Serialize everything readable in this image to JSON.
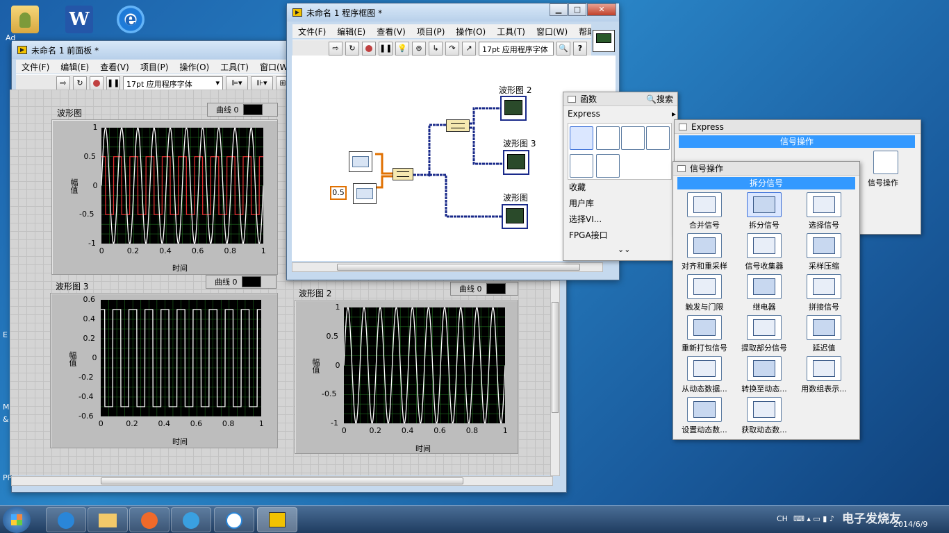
{
  "desktop": {
    "icons": [
      {
        "name": "user-folder",
        "label": "Ad"
      },
      {
        "name": "word",
        "label": ""
      },
      {
        "name": "ie",
        "label": ""
      }
    ],
    "left_edge_labels": [
      "E",
      "M",
      "&",
      "PP"
    ]
  },
  "front_panel": {
    "title": "未命名 1 前面板 *",
    "menu": [
      "文件(F)",
      "编辑(E)",
      "查看(V)",
      "项目(P)",
      "操作(O)",
      "工具(T)",
      "窗口(W)"
    ],
    "font": "17pt 应用程序字体",
    "graphs": [
      {
        "title": "波形图",
        "legend": "曲线 0",
        "yticks": [
          "1",
          "0.5",
          "0",
          "-0.5",
          "-1"
        ],
        "xticks": [
          "0",
          "0.2",
          "0.4",
          "0.6",
          "0.8",
          "1"
        ],
        "xlabel": "时间",
        "ylabel": "幅值"
      },
      {
        "title": "波形图 3",
        "legend": "曲线 0",
        "yticks": [
          "0.6",
          "0.4",
          "0.2",
          "0",
          "-0.2",
          "-0.4",
          "-0.6"
        ],
        "xticks": [
          "0",
          "0.2",
          "0.4",
          "0.6",
          "0.8",
          "1"
        ],
        "xlabel": "时间",
        "ylabel": "幅值"
      },
      {
        "title": "波形图 2",
        "legend": "曲线 0",
        "yticks": [
          "1",
          "0.5",
          "0",
          "-0.5",
          "-1"
        ],
        "xticks": [
          "0",
          "0.2",
          "0.4",
          "0.6",
          "0.8",
          "1"
        ],
        "xlabel": "时间",
        "ylabel": "幅值"
      }
    ]
  },
  "block_diagram": {
    "title": "未命名 1 程序框图 *",
    "menu": [
      "文件(F)",
      "编辑(E)",
      "查看(V)",
      "项目(P)",
      "操作(O)",
      "工具(T)",
      "窗口(W)",
      "帮助(H)"
    ],
    "font": "17pt 应用程序字体",
    "labels": {
      "graph2": "波形图 2",
      "graph3": "波形图 3",
      "graph1": "波形图",
      "const": "0.5"
    }
  },
  "functions_palette": {
    "title": "函数",
    "search": "搜索",
    "category": "Express",
    "list": [
      "收藏",
      "用户库",
      "选择VI...",
      "FPGA接口"
    ]
  },
  "express_palette": {
    "title": "Express",
    "bar": "信号操作",
    "item_label": "信号操作"
  },
  "signal_palette": {
    "title": "信号操作",
    "bar": "拆分信号",
    "items": [
      "合并信号",
      "拆分信号",
      "选择信号",
      "对齐和重采样",
      "信号收集器",
      "采样压缩",
      "触发与门限",
      "继电器",
      "拼接信号",
      "重新打包信号",
      "提取部分信号",
      "延迟值",
      "从动态数据...",
      "转换至动态...",
      "用数组表示...",
      "设置动态数...",
      "获取动态数..."
    ]
  },
  "taskbar": {
    "lang": "CH",
    "date": "2014/6/9",
    "watermark": "电子发烧友"
  },
  "colors": {
    "plot_bg": "#000000",
    "grid": "#1e6b1e",
    "trace_white": "#ffffff",
    "trace_red": "#e03030",
    "selection": "#3399ff",
    "wire_blue": "#1a2a8a",
    "wire_orange": "#e07000"
  }
}
